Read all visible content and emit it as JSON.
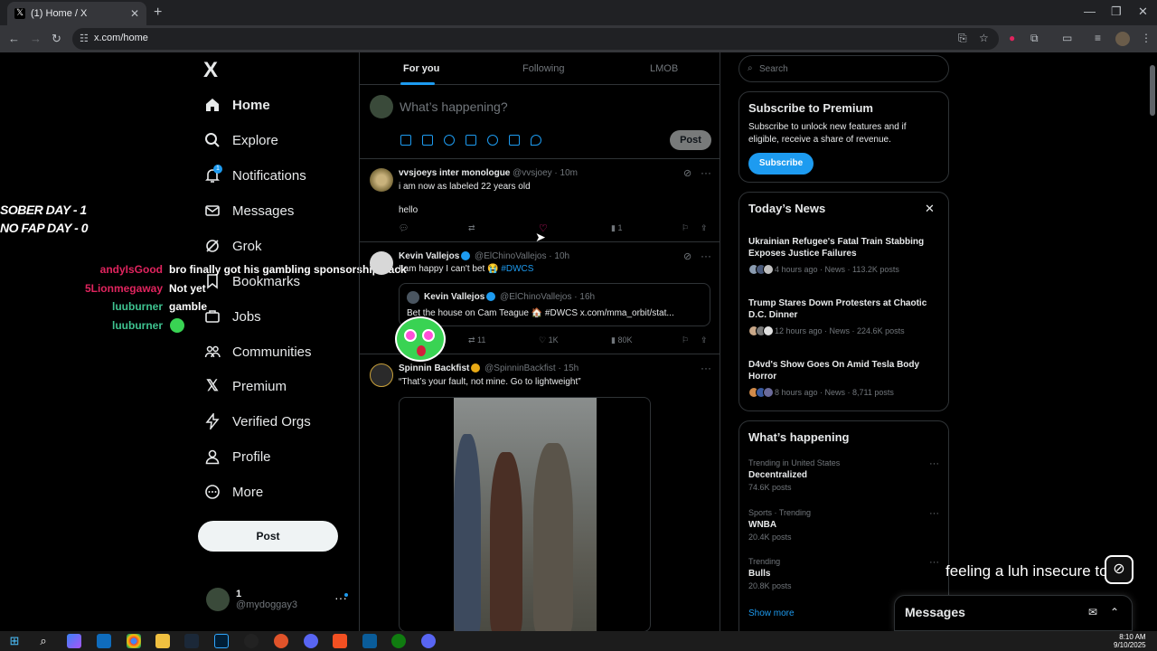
{
  "browser": {
    "tab_title": "(1) Home / X",
    "new_tab": "+",
    "url": "x.com/home",
    "win_min": "—",
    "win_restore": "❐",
    "win_close": "✕"
  },
  "nav": {
    "logo": "X",
    "items": [
      {
        "label": "Home",
        "icon": "home-icon"
      },
      {
        "label": "Explore",
        "icon": "search-icon"
      },
      {
        "label": "Notifications",
        "icon": "bell-icon",
        "badge": "1"
      },
      {
        "label": "Messages",
        "icon": "mail-icon"
      },
      {
        "label": "Grok",
        "icon": "grok-icon"
      },
      {
        "label": "Bookmarks",
        "icon": "bookmark-icon"
      },
      {
        "label": "Jobs",
        "icon": "briefcase-icon"
      },
      {
        "label": "Communities",
        "icon": "people-icon"
      },
      {
        "label": "Premium",
        "icon": "x-icon"
      },
      {
        "label": "Verified Orgs",
        "icon": "lightning-icon"
      },
      {
        "label": "Profile",
        "icon": "person-icon"
      },
      {
        "label": "More",
        "icon": "more-circle-icon"
      }
    ],
    "post_button": "Post",
    "account": {
      "name": "1",
      "handle": "@mydoggay3"
    }
  },
  "overlay": {
    "sober": "SOBER DAY - 1",
    "nofap": "NO FAP DAY - 0",
    "chat": [
      {
        "user": "andyIsGood",
        "color": "#e0245e",
        "msg": "bro finally got his gambling sponsorship back"
      },
      {
        "user": "5Lionmegaway",
        "color": "#e0245e",
        "msg": "Not yet"
      },
      {
        "user": "luuburner",
        "color": "#3ec28f",
        "msg": "gamble"
      },
      {
        "user": "luuburner",
        "color": "#3ec28f",
        "msg": ""
      }
    ],
    "caption": "feeling a luh insecure today"
  },
  "timeline": {
    "tabs": [
      "For you",
      "Following",
      "LMOB"
    ],
    "composer_placeholder": "What’s happening?",
    "composer_post": "Post",
    "tweets": [
      {
        "name": "vvsjoeys inter monologue",
        "meta": "@vvsjoey · 10m",
        "text1": "i am now as labeled 22 years old",
        "text2": "hello",
        "views": "1"
      },
      {
        "name": "Kevin Vallejos",
        "meta": "@ElChinoVallejos · 10h",
        "text": "I am happy I can't bet 😭",
        "hashtag": "#DWCS",
        "quote_name": "Kevin Vallejos",
        "quote_meta": "@ElChinoVallejos · 16h",
        "quote_text": "Bet the house on Cam Teague 🏠 #DWCS x.com/mma_orbit/stat...",
        "retweets": "11",
        "likes": "1K",
        "views": "80K"
      },
      {
        "name": "Spinnin Backfist",
        "meta": "@SpinninBackfist · 15h",
        "text": "“That’s your fault, not mine. Go to lightweight”"
      }
    ]
  },
  "sidebar": {
    "search_placeholder": "Search",
    "premium": {
      "title": "Subscribe to Premium",
      "desc": "Subscribe to unlock new features and if eligible, receive a share of revenue.",
      "button": "Subscribe"
    },
    "news": {
      "title": "Today’s News",
      "close": "✕",
      "items": [
        {
          "title": "Ukrainian Refugee's Fatal Train Stabbing Exposes Justice Failures",
          "meta": "4 hours ago · News · 113.2K posts"
        },
        {
          "title": "Trump Stares Down Protesters at Chaotic D.C. Dinner",
          "meta": "12 hours ago · News · 224.6K posts"
        },
        {
          "title": "D4vd's Show Goes On Amid Tesla Body Horror",
          "meta": "8 hours ago · News · 8,711 posts"
        }
      ]
    },
    "happening": {
      "title": "What’s happening",
      "trends": [
        {
          "context": "Trending in United States",
          "name": "Decentralized",
          "count": "74.6K posts"
        },
        {
          "context": "Sports · Trending",
          "name": "WNBA",
          "count": "20.4K posts"
        },
        {
          "context": "Trending",
          "name": "Bulls",
          "count": "20.8K posts"
        }
      ],
      "show_more": "Show more"
    },
    "messages": "Messages"
  },
  "taskbar": {
    "time": "8:10 AM",
    "date": "9/10/2025"
  }
}
